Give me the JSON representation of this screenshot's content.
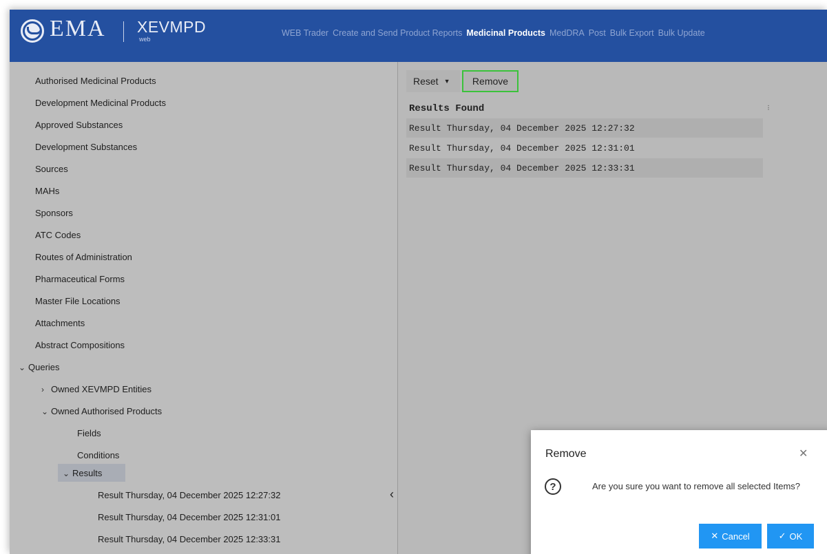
{
  "header": {
    "brand": "EMA",
    "product": "XEVMPD",
    "product_sub": "web",
    "nav": [
      {
        "label": "WEB Trader",
        "active": false
      },
      {
        "label": "Create and Send Product Reports",
        "active": false
      },
      {
        "label": "Medicinal Products",
        "active": true
      },
      {
        "label": "MedDRA",
        "active": false
      },
      {
        "label": "Post",
        "active": false
      },
      {
        "label": "Bulk Export",
        "active": false
      },
      {
        "label": "Bulk Update",
        "active": false
      }
    ]
  },
  "tree": {
    "items": [
      "Authorised Medicinal Products",
      "Development Medicinal Products",
      "Approved Substances",
      "Development Substances",
      "Sources",
      "MAHs",
      "Sponsors",
      "ATC Codes",
      "Routes of Administration",
      "Pharmaceutical Forms",
      "Master File Locations",
      "Attachments",
      "Abstract Compositions"
    ],
    "queries": "Queries",
    "owned_entities": "Owned XEVMPD Entities",
    "owned_authorised": "Owned Authorised Products",
    "fields": "Fields",
    "conditions": "Conditions",
    "results": "Results",
    "result_items": [
      "Result Thursday, 04 December 2025 12:27:32",
      "Result Thursday, 04 December 2025 12:31:01",
      "Result Thursday, 04 December 2025 12:33:31"
    ]
  },
  "toolbar": {
    "reset": "Reset",
    "remove": "Remove"
  },
  "results_table": {
    "header": "Results Found",
    "rows": [
      "Result Thursday, 04 December 2025 12:27:32",
      "Result Thursday, 04 December 2025 12:31:01",
      "Result Thursday, 04 December 2025 12:33:31"
    ]
  },
  "dialog": {
    "title": "Remove",
    "message": "Are you sure you want to remove all selected Items?",
    "cancel": "Cancel",
    "ok": "OK"
  }
}
